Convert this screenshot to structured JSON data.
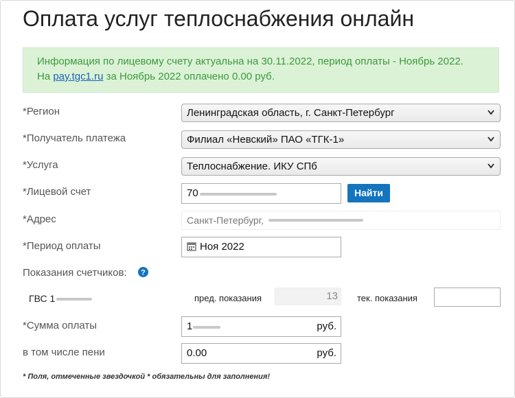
{
  "header": {
    "title": "Оплата услуг теплоснабжения онлайн"
  },
  "info": {
    "line1": "Информация по лицевому счету актуальна на 30.11.2022, период оплаты - Ноябрь 2022.",
    "line2_prefix": "На ",
    "link_text": "pay.tgc1.ru",
    "line2_suffix": " за Ноябрь 2022 оплачено 0.00 руб.",
    "colors": {
      "background": "#dcf2d7",
      "text": "#3b9a3b",
      "link": "#1a62b3"
    }
  },
  "form": {
    "region": {
      "label": "*Регион",
      "value": "Ленинградская область, г. Санкт-Петербург"
    },
    "recipient": {
      "label": "*Получатель платежа",
      "value": "Филиал «Невский» ПАО «ТГК-1»"
    },
    "service": {
      "label": "*Услуга",
      "value": "Теплоснабжение. ИКУ СПб"
    },
    "account": {
      "label": "*Лицевой счет",
      "value": "70",
      "find_button": "Найти"
    },
    "address": {
      "label": "*Адрес",
      "value": "Санкт-Петербург,"
    },
    "period": {
      "label": "*Период оплаты",
      "value": "Ноя 2022",
      "icon": "calendar-icon"
    },
    "meters": {
      "label": "Показания счетчиков:",
      "help_icon": "question-circle-icon",
      "rows": [
        {
          "name": "ГВС 1",
          "prev_label": "пред. показания",
          "prev_value": "13",
          "cur_label": "тек. показания",
          "cur_value": ""
        }
      ]
    },
    "amount": {
      "label": "*Сумма оплаты",
      "value": "1",
      "currency": "руб."
    },
    "penalty": {
      "label": "в том числе пени",
      "value": "0.00",
      "currency": "руб."
    },
    "footnote": "* Поля, отмеченные звездочкой * обязательны для заполнения!",
    "colors": {
      "button": "#1474be",
      "help_icon": "#1474be"
    }
  }
}
